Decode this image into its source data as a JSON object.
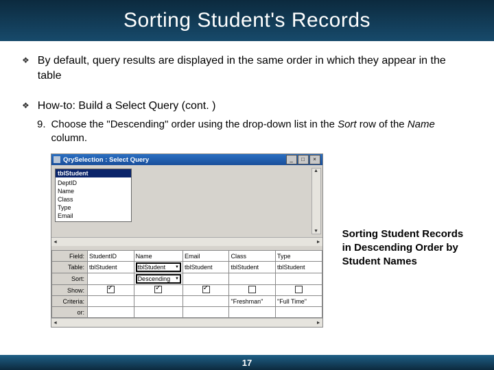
{
  "title": "Sorting Student's Records",
  "bullets": [
    "By default, query results are displayed in the same order in which they appear in the table",
    "How-to: Build a Select Query (cont. )"
  ],
  "step": {
    "num": "9.",
    "pre": "Choose the \"Descending\" order using the drop-down list in the ",
    "it1": "Sort",
    "mid": " row of the ",
    "it2": "Name",
    "post": " column."
  },
  "ss": {
    "winTitle": "QrySelection : Select Query",
    "tableHeader": "tblStudent",
    "fields": [
      "DeptID",
      "Name",
      "Class",
      "Type",
      "Email"
    ],
    "gridLabels": {
      "field": "Field:",
      "table": "Table:",
      "sort": "Sort:",
      "show": "Show:",
      "criteria": "Criteria:",
      "or": "or:"
    },
    "cols": [
      {
        "field": "StudentID",
        "table": "tblStudent",
        "sort": "",
        "show": true,
        "criteria": ""
      },
      {
        "field": "Name",
        "table": "tblStudent",
        "sort": "Descending",
        "show": true,
        "criteria": ""
      },
      {
        "field": "Email",
        "table": "tblStudent",
        "sort": "",
        "show": true,
        "criteria": ""
      },
      {
        "field": "Class",
        "table": "tblStudent",
        "sort": "",
        "show": false,
        "criteria": "\"Freshman\""
      },
      {
        "field": "Type",
        "table": "tblStudent",
        "sort": "",
        "show": false,
        "criteria": "\"Full Time\""
      }
    ]
  },
  "callout": "Sorting Student Records in Descending Order by Student Names",
  "pageNumber": "17"
}
